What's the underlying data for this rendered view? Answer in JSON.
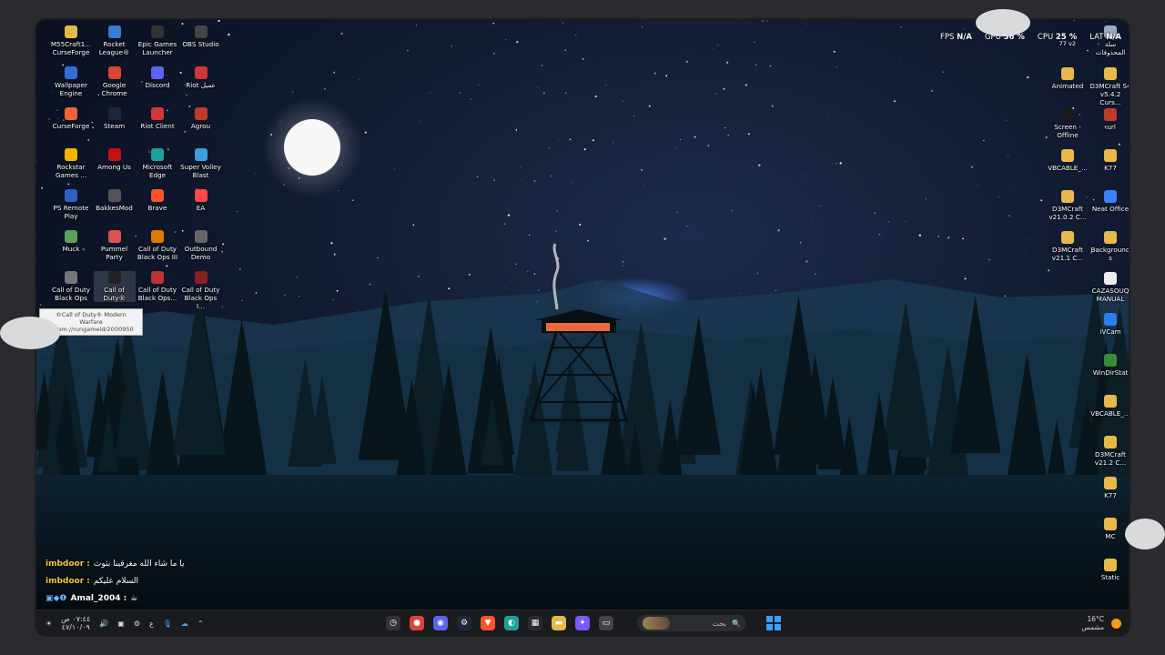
{
  "desktop": {
    "left_icons": [
      {
        "label": "M55Craft1... CurseForge",
        "icon": "folder-icon",
        "color": "#e6b94a"
      },
      {
        "label": "Rocket League®",
        "icon": "rocket-league-icon",
        "color": "#3a7bd5"
      },
      {
        "label": "Epic Games Launcher",
        "icon": "epic-games-icon",
        "color": "#333333"
      },
      {
        "label": "OBS Studio",
        "icon": "obs-icon",
        "color": "#444444"
      },
      {
        "label": "Wallpaper Engine",
        "icon": "wallpaper-engine-icon",
        "color": "#2f6fd6"
      },
      {
        "label": "Google Chrome",
        "icon": "chrome-icon",
        "color": "#db4437"
      },
      {
        "label": "Discord",
        "icon": "discord-icon",
        "color": "#5865f2"
      },
      {
        "label": "Riot عميل",
        "icon": "riot-icon",
        "color": "#d13639"
      },
      {
        "label": "CurseForge",
        "icon": "curseforge-icon",
        "color": "#f16436"
      },
      {
        "label": "Steam",
        "icon": "steam-icon",
        "color": "#1b2838"
      },
      {
        "label": "Riot Client",
        "icon": "riot-client-icon",
        "color": "#d13639"
      },
      {
        "label": "Agrou",
        "icon": "agrou-icon",
        "color": "#c0392b"
      },
      {
        "label": "Rockstar Games ...",
        "icon": "rockstar-icon",
        "color": "#f4b400"
      },
      {
        "label": "Among Us",
        "icon": "among-us-icon",
        "color": "#c51111"
      },
      {
        "label": "Microsoft Edge",
        "icon": "edge-icon",
        "color": "#1fa0a0"
      },
      {
        "label": "Super Volley Blast",
        "icon": "volley-icon",
        "color": "#3aa0d8"
      },
      {
        "label": "PS Remote Play",
        "icon": "ps-remote-icon",
        "color": "#2a62c9"
      },
      {
        "label": "BakkesMod",
        "icon": "bakkesmod-icon",
        "color": "#555555"
      },
      {
        "label": "Brave",
        "icon": "brave-icon",
        "color": "#fb542b"
      },
      {
        "label": "EA",
        "icon": "ea-icon",
        "color": "#ff4747"
      },
      {
        "label": "Muck",
        "icon": "muck-icon",
        "color": "#5aa05a"
      },
      {
        "label": "Pummel Party",
        "icon": "pummel-icon",
        "color": "#d9534f"
      },
      {
        "label": "Call of Duty Black Ops III",
        "icon": "cod-icon",
        "color": "#e07b00"
      },
      {
        "label": "Outbound Demo",
        "icon": "outbound-icon",
        "color": "#666666"
      },
      {
        "label": "Call of Duty Black Ops",
        "icon": "cod-icon",
        "color": "#777777"
      },
      {
        "label": "Call of Duty®",
        "icon": "cod-icon",
        "color": "#222222"
      },
      {
        "label": "Call of Duty Black Ops...",
        "icon": "cod-icon",
        "color": "#b33"
      },
      {
        "label": "Call of Duty Black Ops I...",
        "icon": "cod-icon",
        "color": "#8b1e1e"
      }
    ],
    "right_icons": [
      {
        "label": "سلة المحذوفات",
        "icon": "recycle-bin-icon",
        "color": "#9ab"
      },
      {
        "label": "Animated",
        "icon": "folder-icon",
        "color": "#e6b94a"
      },
      {
        "label": "D3MCraft S4 v5.4.2 Curs...",
        "icon": "folder-icon",
        "color": "#e6b94a"
      },
      {
        "label": "Screen - Offline",
        "icon": "screen-icon",
        "color": "#1a1a1a"
      },
      {
        "label": ".url",
        "icon": "url-icon",
        "color": "#c0392b"
      },
      {
        "label": "VBCABLE_...",
        "icon": "folder-icon",
        "color": "#e6b94a"
      },
      {
        "label": "K77",
        "icon": "folder-icon",
        "color": "#e6b94a"
      },
      {
        "label": "D3MCraft v21.0.2 C...",
        "icon": "folder-icon",
        "color": "#e6b94a"
      },
      {
        "label": "Neat Office",
        "icon": "neat-office-icon",
        "color": "#3b82f6"
      },
      {
        "label": "D3MCraft v21.1 C...",
        "icon": "folder-icon",
        "color": "#e6b94a"
      },
      {
        "label": "Backgrounds",
        "icon": "folder-icon",
        "color": "#e6b94a"
      },
      {
        "label": "CAZASOUQ MANUAL",
        "icon": "document-icon",
        "color": "#eeeeee"
      },
      {
        "label": "iVCam",
        "icon": "ivcam-icon",
        "color": "#2b7de9"
      },
      {
        "label": "WinDirStat",
        "icon": "windirstat-icon",
        "color": "#3a8a3a"
      },
      {
        "label": "VBCABLE_...",
        "icon": "folder-icon",
        "color": "#e6b94a"
      },
      {
        "label": "D3MCraft v21.2 C...",
        "icon": "folder-icon",
        "color": "#e6b94a"
      },
      {
        "label": "K77",
        "icon": "folder-icon",
        "color": "#e6b94a"
      },
      {
        "label": "MC",
        "icon": "folder-icon",
        "color": "#e6b94a"
      },
      {
        "label": "Static",
        "icon": "folder-icon",
        "color": "#e6b94a"
      }
    ],
    "tooltip": {
      "line1": "®Call of Duty® Modern Warfare",
      "line2": "steam://rungameid/2000950"
    }
  },
  "hud": {
    "fps_label": "FPS",
    "fps_value": "N/A",
    "gpu_label": "GPU",
    "gpu_value": "36 %",
    "cpu_label": "CPU",
    "cpu_value": "25 %",
    "lat_label": "LAT",
    "lat_value": "N/A",
    "overlay_badge": "77 v2"
  },
  "chat": [
    {
      "user": "imbdoor :",
      "message": "يا ما شاء الله مغرقينا بثوث",
      "badges": ""
    },
    {
      "user": "imbdoor :",
      "message": "السلام عليكم",
      "badges": ""
    },
    {
      "user": "Amal_2004 :",
      "message": "☕",
      "badges": "▣◆❶"
    }
  ],
  "taskbar": {
    "tray_time": "٠٧:٤٤ ص",
    "tray_date": "٤٧/١٠/٠٩",
    "lang": "ع",
    "search_placeholder": "بحث",
    "weather_temp": "16°C",
    "weather_desc": "مشمس",
    "apps": [
      {
        "icon": "clock-app-icon",
        "color": "#333333",
        "glyph": "◷"
      },
      {
        "icon": "chrome-icon",
        "color": "#db4437",
        "glyph": "●"
      },
      {
        "icon": "discord-icon",
        "color": "#5865f2",
        "glyph": "◉"
      },
      {
        "icon": "steam-icon",
        "color": "#1b2838",
        "glyph": "⚙"
      },
      {
        "icon": "brave-icon",
        "color": "#fb542b",
        "glyph": "▼"
      },
      {
        "icon": "edge-icon",
        "color": "#1fa0a0",
        "glyph": "◐"
      },
      {
        "icon": "store-icon",
        "color": "#2b2b2b",
        "glyph": "▦"
      },
      {
        "icon": "file-explorer-icon",
        "color": "#e6b94a",
        "glyph": "▬"
      },
      {
        "icon": "copilot-icon",
        "color": "#7a5af8",
        "glyph": "✦"
      },
      {
        "icon": "taskview-icon",
        "color": "#444444",
        "glyph": "▭"
      }
    ]
  }
}
